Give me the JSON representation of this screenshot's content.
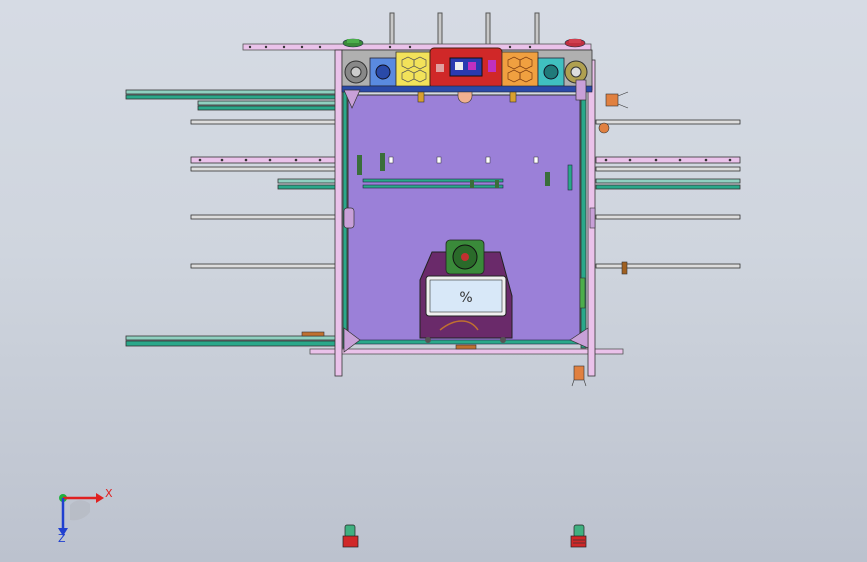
{
  "viewport": {
    "background_top": "#d6dbe4",
    "background_bottom": "#bcc2ce"
  },
  "triad": {
    "x_label": "X",
    "z_label": "Z",
    "x_color": "#e02020",
    "y_color": "#20b040",
    "z_color": "#2040d0"
  },
  "model": {
    "bed_color": "#9b80d8",
    "frame_color": "#e8b8e8",
    "rail_color": "#2aa88a",
    "accent_red": "#d02828"
  }
}
